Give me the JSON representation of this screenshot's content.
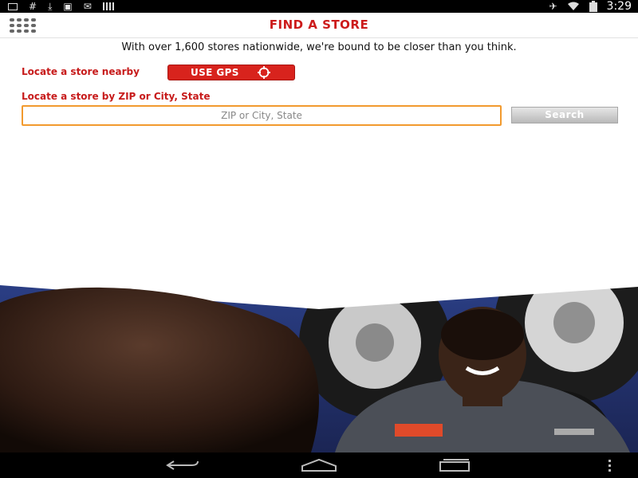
{
  "status_bar": {
    "time": "3:29",
    "left_icons": [
      "notification-icon",
      "hash-icon",
      "download-icon",
      "gallery-icon",
      "mail-icon",
      "barcode-icon"
    ],
    "right_icons": [
      "airplane-icon",
      "wifi-icon",
      "battery-icon"
    ]
  },
  "header": {
    "title": "FIND A STORE",
    "menu_icon": "grid-menu-icon"
  },
  "main": {
    "intro": "With over 1,600 stores nationwide, we're bound to be closer than you think.",
    "nearby_label": "Locate a store nearby",
    "gps_button_label": "USE GPS",
    "gps_icon": "crosshair-icon",
    "zip_label": "Locate a store by ZIP or City, State",
    "zip_placeholder": "ZIP or City, State",
    "zip_value": "",
    "search_button_label": "Search"
  },
  "colors": {
    "brand_red": "#cc1b1b",
    "input_focus": "#f29a2e",
    "button_gray": "#c8c8c8"
  },
  "nav_bar": {
    "icons": [
      "back-icon",
      "home-icon",
      "recents-icon",
      "overflow-menu-icon"
    ]
  }
}
